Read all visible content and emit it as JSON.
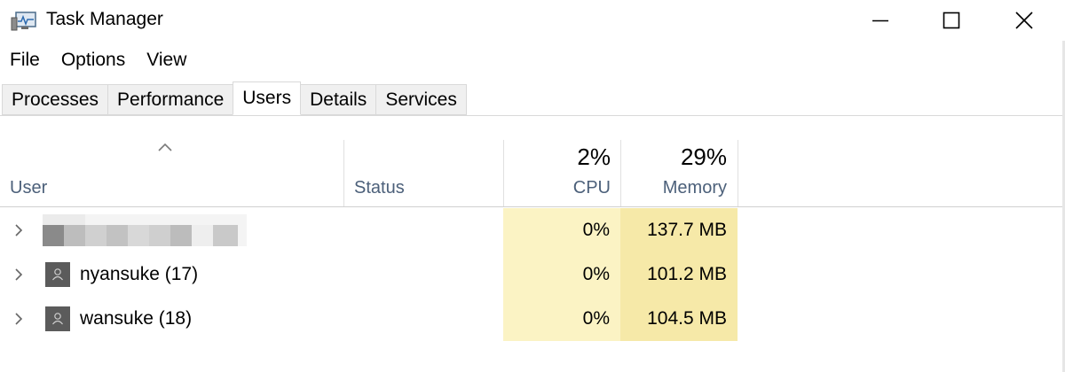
{
  "window": {
    "title": "Task Manager",
    "controls": {
      "minimize": "minimize",
      "maximize": "maximize",
      "close": "close"
    }
  },
  "menu": [
    "File",
    "Options",
    "View"
  ],
  "tabs": [
    {
      "label": "Processes",
      "active": false
    },
    {
      "label": "Performance",
      "active": false
    },
    {
      "label": "Users",
      "active": true
    },
    {
      "label": "Details",
      "active": false
    },
    {
      "label": "Services",
      "active": false
    }
  ],
  "columns": {
    "user": "User",
    "status": "Status",
    "cpu": {
      "label": "CPU",
      "total": "2%"
    },
    "memory": {
      "label": "Memory",
      "total": "29%"
    }
  },
  "rows": [
    {
      "name": "",
      "status": "",
      "cpu": "0%",
      "memory": "137.7 MB",
      "redacted": true
    },
    {
      "name": "nyansuke (17)",
      "status": "",
      "cpu": "0%",
      "memory": "101.2 MB",
      "redacted": false
    },
    {
      "name": "wansuke (18)",
      "status": "",
      "cpu": "0%",
      "memory": "104.5 MB",
      "redacted": false
    }
  ],
  "colors": {
    "cpu_heat": "#fbf3c4",
    "memory_heat": "#f6e9a8",
    "header_text": "#4c607a"
  }
}
